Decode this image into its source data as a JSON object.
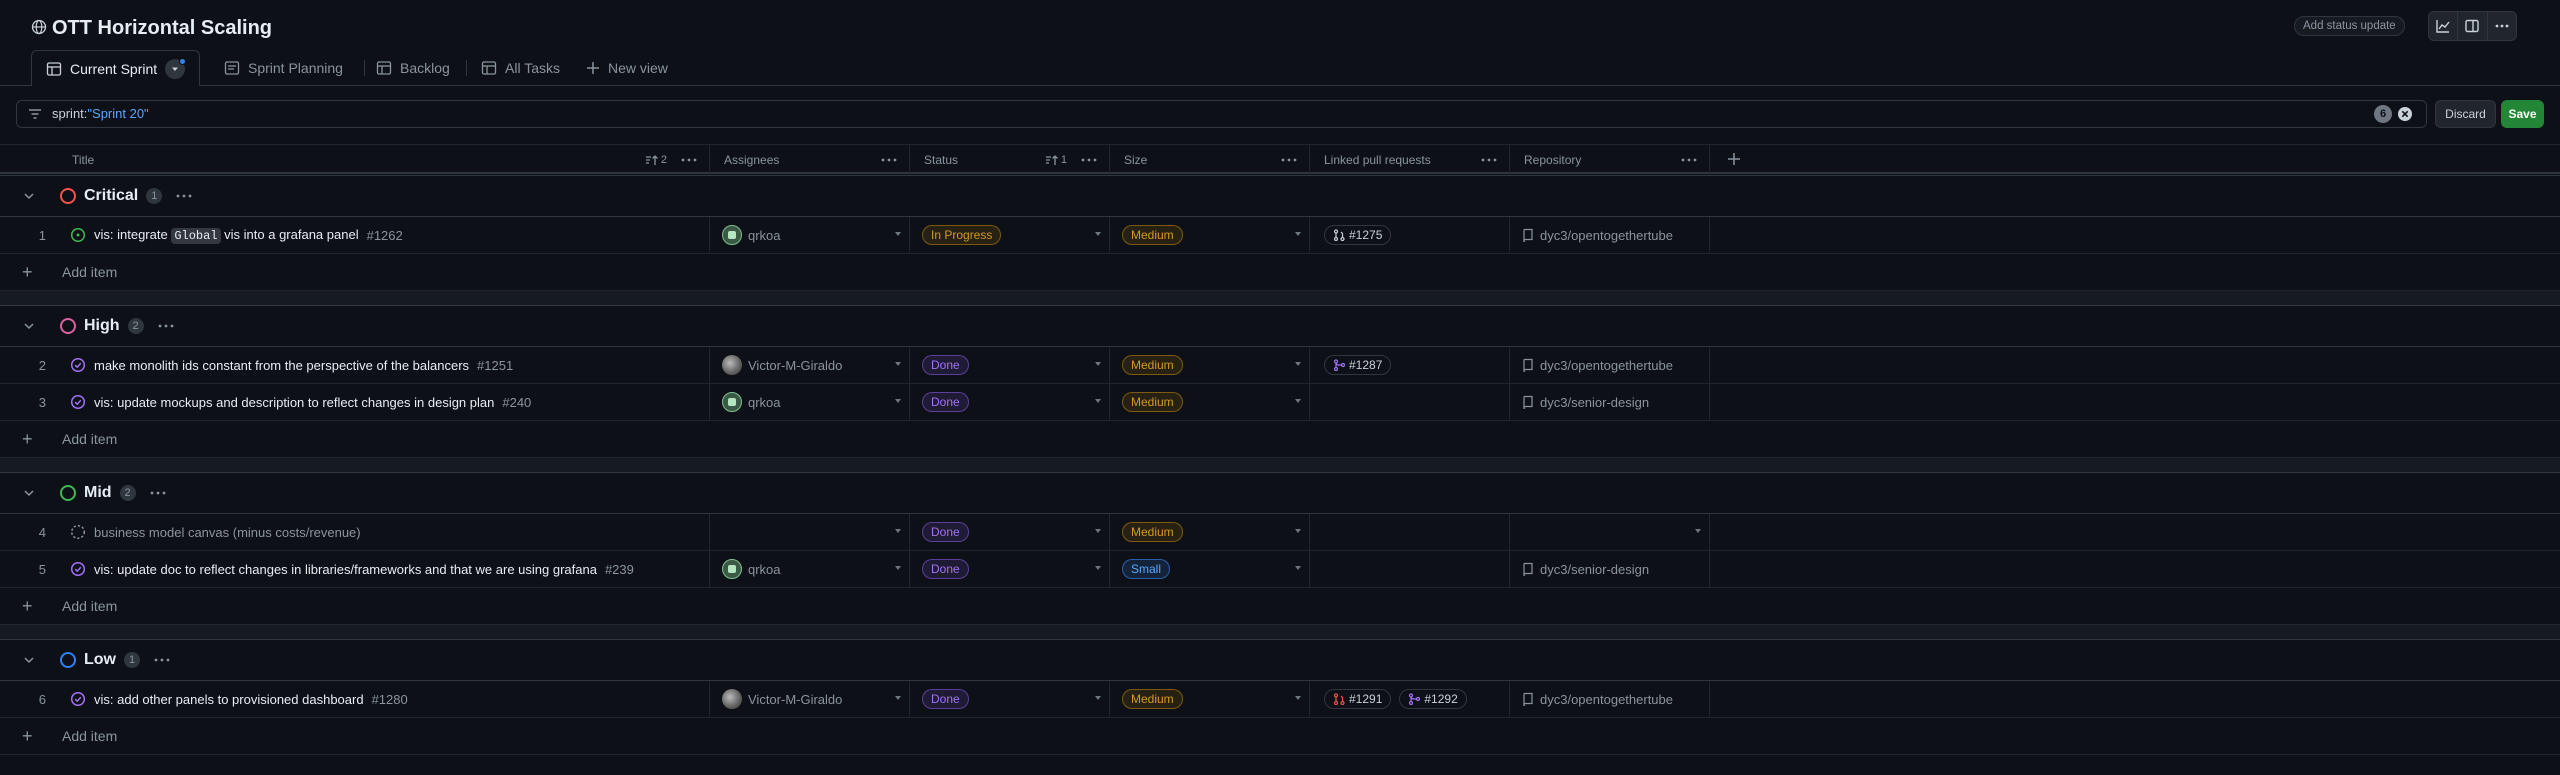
{
  "header": {
    "title": "OTT Horizontal Scaling",
    "add_status_update": "Add status update"
  },
  "tabs": [
    {
      "label": "Current Sprint",
      "icon": "table-icon"
    },
    {
      "label": "Sprint Planning",
      "icon": "board-icon"
    },
    {
      "label": "Backlog",
      "icon": "table-icon"
    },
    {
      "label": "All Tasks",
      "icon": "table-icon"
    },
    {
      "label": "New view",
      "icon": "plus-icon"
    }
  ],
  "filter": {
    "key": "sprint:",
    "value": "\"Sprint 20\"",
    "count": "6",
    "discard_label": "Discard",
    "save_label": "Save"
  },
  "columns": {
    "title": {
      "label": "Title",
      "sort": "2"
    },
    "assignees": {
      "label": "Assignees"
    },
    "status": {
      "label": "Status",
      "sort": "1"
    },
    "size": {
      "label": "Size"
    },
    "linked_prs": {
      "label": "Linked pull requests"
    },
    "repository": {
      "label": "Repository"
    }
  },
  "add_item_label": "Add item",
  "groups": [
    {
      "name": "Critical",
      "count": "1",
      "color": "#f85149",
      "rows": [
        {
          "num": "1",
          "title_pre": "vis: integrate ",
          "code": "Global",
          "title_post": " vis into a grafana panel",
          "issue": "#1262",
          "icon": "issue-open-icon",
          "assignee": "qrkoa",
          "avatar": "q",
          "status": "In Progress",
          "status_kind": "inprog",
          "size": "Medium",
          "size_kind": "medium",
          "prs": [
            {
              "num": "#1275",
              "kind": "pr-open-icon"
            }
          ],
          "repo": "dyc3/opentogethertube"
        }
      ]
    },
    {
      "name": "High",
      "count": "2",
      "color": "#db61a2",
      "rows": [
        {
          "num": "2",
          "title_pre": "make monolith ids constant from the perspective of the balancers",
          "code": "",
          "title_post": "",
          "issue": "#1251",
          "icon": "issue-closed-icon",
          "assignee": "Victor-M-Giraldo",
          "avatar": "v",
          "status": "Done",
          "status_kind": "done",
          "size": "Medium",
          "size_kind": "medium",
          "prs": [
            {
              "num": "#1287",
              "kind": "pr-merged-icon"
            }
          ],
          "repo": "dyc3/opentogethertube"
        },
        {
          "num": "3",
          "title_pre": "vis: update mockups and description to reflect changes in design plan",
          "code": "",
          "title_post": "",
          "issue": "#240",
          "icon": "issue-closed-icon",
          "assignee": "qrkoa",
          "avatar": "q",
          "status": "Done",
          "status_kind": "done",
          "size": "Medium",
          "size_kind": "medium",
          "prs": [],
          "repo": "dyc3/senior-design"
        }
      ]
    },
    {
      "name": "Mid",
      "count": "2",
      "color": "#3fb950",
      "rows": [
        {
          "num": "4",
          "title_pre": "business model canvas (minus costs/revenue)",
          "code": "",
          "title_post": "",
          "issue": "",
          "icon": "draft-icon",
          "assignee": "",
          "avatar": "",
          "status": "Done",
          "status_kind": "done",
          "size": "Medium",
          "size_kind": "medium",
          "prs": [],
          "repo": ""
        },
        {
          "num": "5",
          "title_pre": "vis: update doc to reflect changes in libraries/frameworks and that we are using grafana",
          "code": "",
          "title_post": "",
          "issue": "#239",
          "icon": "issue-closed-icon",
          "assignee": "qrkoa",
          "avatar": "q",
          "status": "Done",
          "status_kind": "done",
          "size": "Small",
          "size_kind": "small",
          "prs": [],
          "repo": "dyc3/senior-design"
        }
      ]
    },
    {
      "name": "Low",
      "count": "1",
      "color": "#2f81f7",
      "rows": [
        {
          "num": "6",
          "title_pre": "vis: add other panels to provisioned dashboard",
          "code": "",
          "title_post": "",
          "issue": "#1280",
          "icon": "issue-closed-icon",
          "assignee": "Victor-M-Giraldo",
          "avatar": "v",
          "status": "Done",
          "status_kind": "done",
          "size": "Medium",
          "size_kind": "medium",
          "prs": [
            {
              "num": "#1291",
              "kind": "pr-closed-icon"
            },
            {
              "num": "#1292",
              "kind": "pr-merged-icon"
            }
          ],
          "repo": "dyc3/opentogethertube"
        }
      ]
    }
  ]
}
